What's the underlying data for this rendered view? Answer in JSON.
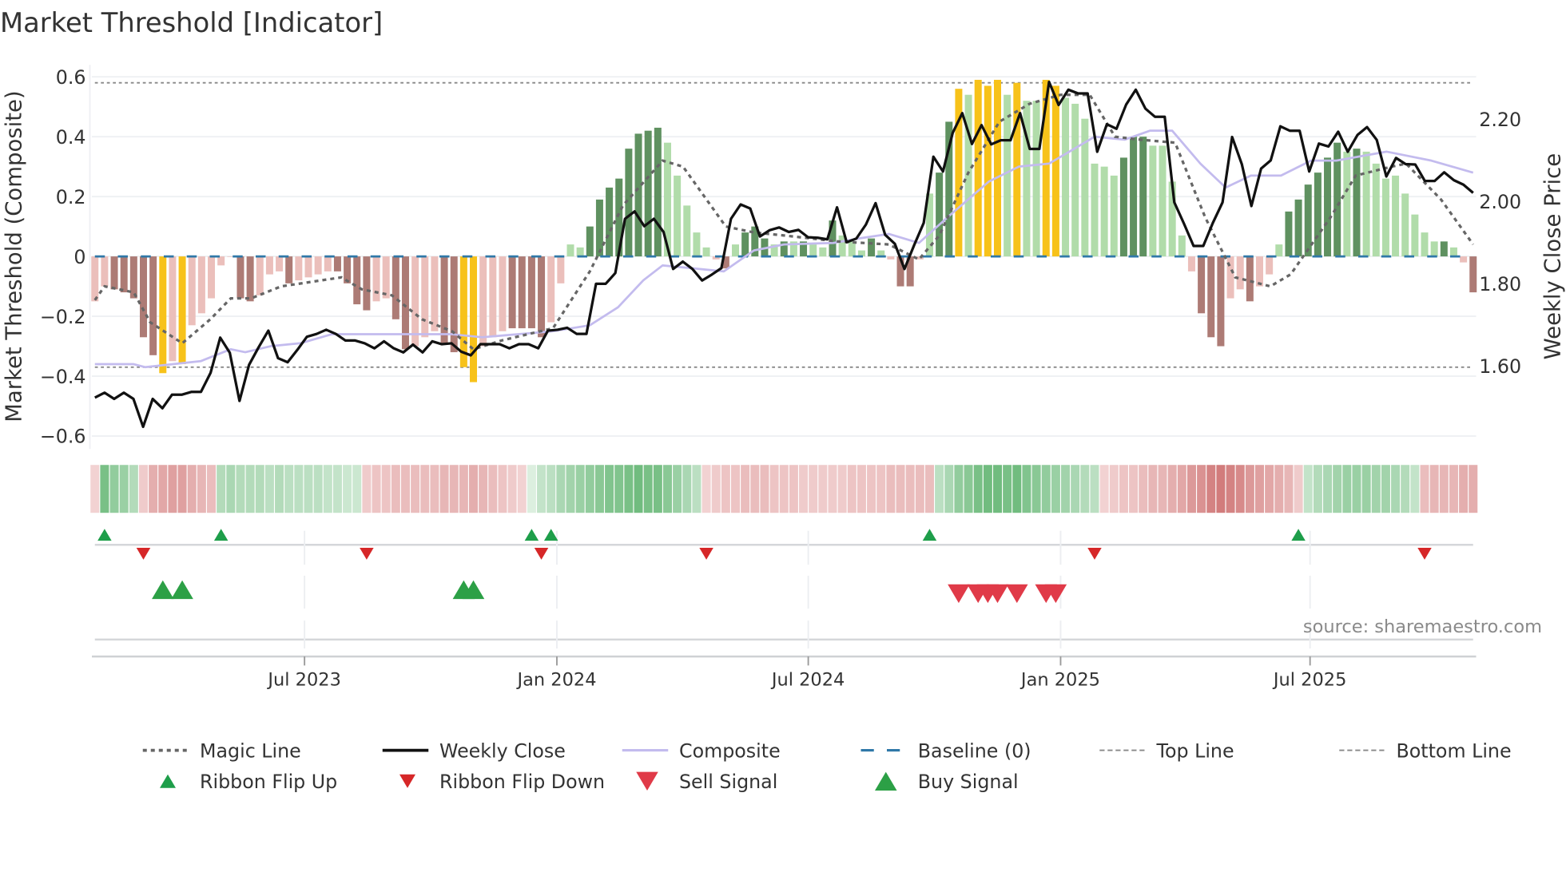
{
  "chart_data": {
    "type": "bar",
    "title": "Market Threshold [Indicator]",
    "ylabel_left": "Market Threshold (Composite)",
    "ylabel_right": "Weekly Close Price",
    "source": "source: sharemaestro.com",
    "ylim_left": [
      -0.65,
      0.62
    ],
    "ylim_right": [
      1.44,
      2.31
    ],
    "left_ticks": [
      0.6,
      0.4,
      0.2,
      0,
      -0.2,
      -0.4,
      -0.6
    ],
    "left_tick_labels": [
      "0.6",
      "0.4",
      "0.2",
      "0",
      "−0.2",
      "−0.4",
      "−0.6"
    ],
    "right_ticks": [
      2.2,
      2.0,
      1.8,
      1.6
    ],
    "right_tick_labels": [
      "2.20",
      "2.00",
      "1.80",
      "1.60"
    ],
    "x_ticks": [
      {
        "week": 21.6,
        "label": "Jul 2023"
      },
      {
        "week": 47.6,
        "label": "Jan 2024"
      },
      {
        "week": 73.5,
        "label": "Jul 2024"
      },
      {
        "week": 99.5,
        "label": "Jan 2025"
      },
      {
        "week": 125.2,
        "label": "Jul 2025"
      }
    ],
    "top_line": 0.58,
    "bottom_line": -0.37,
    "baseline": 0,
    "state_colors": {
      "L": "#ebbfbb",
      "D": "#ad7b75",
      "Y": "#f7c21a",
      "g": "#b1dcaa",
      "G": "#5f9160"
    },
    "line_colors": {
      "magic": "#666666",
      "close": "#111111",
      "composite": "#c3bbee",
      "baseline": "#2f78a8",
      "threshold": "#888888"
    },
    "composite_bars": [
      [
        -0.15,
        "L"
      ],
      [
        -0.1,
        "L"
      ],
      [
        -0.11,
        "D"
      ],
      [
        -0.12,
        "D"
      ],
      [
        -0.14,
        "D"
      ],
      [
        -0.27,
        "D"
      ],
      [
        -0.33,
        "D"
      ],
      [
        -0.39,
        "Y"
      ],
      [
        -0.35,
        "L"
      ],
      [
        -0.36,
        "Y"
      ],
      [
        -0.23,
        "L"
      ],
      [
        -0.19,
        "L"
      ],
      [
        -0.14,
        "L"
      ],
      [
        -0.03,
        "L"
      ],
      [
        0,
        "L"
      ],
      [
        -0.14,
        "D"
      ],
      [
        -0.15,
        "D"
      ],
      [
        -0.13,
        "L"
      ],
      [
        -0.06,
        "L"
      ],
      [
        -0.05,
        "L"
      ],
      [
        -0.09,
        "D"
      ],
      [
        -0.08,
        "L"
      ],
      [
        -0.07,
        "L"
      ],
      [
        -0.06,
        "L"
      ],
      [
        -0.05,
        "L"
      ],
      [
        -0.05,
        "D"
      ],
      [
        -0.09,
        "D"
      ],
      [
        -0.16,
        "D"
      ],
      [
        -0.18,
        "D"
      ],
      [
        -0.15,
        "L"
      ],
      [
        -0.14,
        "L"
      ],
      [
        -0.21,
        "D"
      ],
      [
        -0.31,
        "D"
      ],
      [
        -0.3,
        "L"
      ],
      [
        -0.27,
        "L"
      ],
      [
        -0.25,
        "L"
      ],
      [
        -0.29,
        "D"
      ],
      [
        -0.32,
        "D"
      ],
      [
        -0.37,
        "Y"
      ],
      [
        -0.42,
        "Y"
      ],
      [
        -0.3,
        "L"
      ],
      [
        -0.27,
        "L"
      ],
      [
        -0.25,
        "L"
      ],
      [
        -0.24,
        "D"
      ],
      [
        -0.24,
        "D"
      ],
      [
        -0.24,
        "D"
      ],
      [
        -0.27,
        "D"
      ],
      [
        -0.22,
        "L"
      ],
      [
        -0.09,
        "L"
      ],
      [
        0.04,
        "g"
      ],
      [
        0.03,
        "g"
      ],
      [
        0.1,
        "G"
      ],
      [
        0.19,
        "G"
      ],
      [
        0.23,
        "G"
      ],
      [
        0.26,
        "G"
      ],
      [
        0.36,
        "G"
      ],
      [
        0.41,
        "G"
      ],
      [
        0.42,
        "G"
      ],
      [
        0.43,
        "G"
      ],
      [
        0.38,
        "g"
      ],
      [
        0.27,
        "g"
      ],
      [
        0.17,
        "g"
      ],
      [
        0.08,
        "g"
      ],
      [
        0.03,
        "g"
      ],
      [
        -0.01,
        "L"
      ],
      [
        -0.04,
        "D"
      ],
      [
        0.04,
        "g"
      ],
      [
        0.08,
        "G"
      ],
      [
        0.1,
        "G"
      ],
      [
        0.06,
        "G"
      ],
      [
        0.04,
        "g"
      ],
      [
        0.05,
        "G"
      ],
      [
        0.05,
        "g"
      ],
      [
        0.05,
        "G"
      ],
      [
        0.04,
        "g"
      ],
      [
        0.03,
        "g"
      ],
      [
        0.12,
        "G"
      ],
      [
        0.07,
        "g"
      ],
      [
        0.05,
        "g"
      ],
      [
        0.02,
        "g"
      ],
      [
        0.06,
        "G"
      ],
      [
        0.02,
        "g"
      ],
      [
        -0.01,
        "L"
      ],
      [
        -0.1,
        "D"
      ],
      [
        -0.1,
        "D"
      ],
      [
        -0.01,
        "L"
      ],
      [
        0.21,
        "g"
      ],
      [
        0.28,
        "G"
      ],
      [
        0.45,
        "G"
      ],
      [
        0.56,
        "Y"
      ],
      [
        0.54,
        "g"
      ],
      [
        0.59,
        "Y"
      ],
      [
        0.57,
        "Y"
      ],
      [
        0.59,
        "Y"
      ],
      [
        0.54,
        "g"
      ],
      [
        0.58,
        "Y"
      ],
      [
        0.52,
        "g"
      ],
      [
        0.52,
        "g"
      ],
      [
        0.59,
        "Y"
      ],
      [
        0.57,
        "Y"
      ],
      [
        0.53,
        "g"
      ],
      [
        0.51,
        "g"
      ],
      [
        0.46,
        "g"
      ],
      [
        0.31,
        "g"
      ],
      [
        0.3,
        "g"
      ],
      [
        0.27,
        "g"
      ],
      [
        0.33,
        "G"
      ],
      [
        0.4,
        "G"
      ],
      [
        0.4,
        "G"
      ],
      [
        0.37,
        "g"
      ],
      [
        0.37,
        "g"
      ],
      [
        0.25,
        "g"
      ],
      [
        0.07,
        "g"
      ],
      [
        -0.05,
        "L"
      ],
      [
        -0.19,
        "D"
      ],
      [
        -0.27,
        "D"
      ],
      [
        -0.3,
        "D"
      ],
      [
        -0.14,
        "L"
      ],
      [
        -0.11,
        "L"
      ],
      [
        -0.15,
        "D"
      ],
      [
        -0.1,
        "L"
      ],
      [
        -0.06,
        "L"
      ],
      [
        0.04,
        "g"
      ],
      [
        0.15,
        "G"
      ],
      [
        0.19,
        "G"
      ],
      [
        0.24,
        "G"
      ],
      [
        0.28,
        "G"
      ],
      [
        0.33,
        "G"
      ],
      [
        0.38,
        "G"
      ],
      [
        0.35,
        "g"
      ],
      [
        0.36,
        "G"
      ],
      [
        0.35,
        "g"
      ],
      [
        0.31,
        "g"
      ],
      [
        0.26,
        "g"
      ],
      [
        0.27,
        "g"
      ],
      [
        0.21,
        "g"
      ],
      [
        0.14,
        "g"
      ],
      [
        0.08,
        "g"
      ],
      [
        0.05,
        "g"
      ],
      [
        0.05,
        "G"
      ],
      [
        0.03,
        "g"
      ],
      [
        -0.02,
        "L"
      ],
      [
        -0.12,
        "D"
      ]
    ],
    "weekly_close": [
      1.523,
      1.535,
      1.52,
      1.535,
      1.52,
      1.452,
      1.52,
      1.497,
      1.53,
      1.53,
      1.537,
      1.537,
      1.583,
      1.669,
      1.632,
      1.515,
      1.603,
      1.646,
      1.686,
      1.619,
      1.609,
      1.639,
      1.671,
      1.678,
      1.688,
      1.678,
      1.662,
      1.662,
      1.655,
      1.643,
      1.66,
      1.643,
      1.633,
      1.652,
      1.633,
      1.66,
      1.653,
      1.655,
      1.635,
      1.626,
      1.653,
      1.653,
      1.653,
      1.643,
      1.653,
      1.653,
      1.643,
      1.686,
      1.688,
      1.693,
      1.678,
      1.678,
      1.8,
      1.8,
      1.826,
      1.958,
      1.976,
      1.94,
      1.958,
      1.926,
      1.836,
      1.854,
      1.836,
      1.808,
      1.822,
      1.838,
      1.958,
      1.993,
      1.983,
      1.915,
      1.93,
      1.937,
      1.926,
      1.931,
      1.913,
      1.912,
      1.908,
      1.986,
      1.901,
      1.91,
      1.944,
      1.996,
      1.919,
      1.897,
      1.836,
      1.894,
      1.948,
      2.109,
      2.073,
      2.167,
      2.215,
      2.14,
      2.186,
      2.139,
      2.149,
      2.149,
      2.215,
      2.128,
      2.128,
      2.291,
      2.235,
      2.272,
      2.263,
      2.263,
      2.121,
      2.188,
      2.177,
      2.236,
      2.272,
      2.226,
      2.206,
      2.206,
      1.998,
      1.946,
      1.892,
      1.892,
      1.948,
      1.998,
      2.157,
      2.091,
      1.989,
      2.08,
      2.1,
      2.183,
      2.172,
      2.172,
      2.073,
      2.141,
      2.134,
      2.17,
      2.121,
      2.162,
      2.181,
      2.15,
      2.061,
      2.106,
      2.091,
      2.09,
      2.05,
      2.05,
      2.071,
      2.052,
      2.041,
      2.021
    ],
    "composite_line": [
      [
        0,
        -0.36
      ],
      [
        4,
        -0.36
      ],
      [
        5.2,
        -0.37
      ],
      [
        10.9,
        -0.35
      ],
      [
        14,
        -0.31
      ],
      [
        15.5,
        -0.32
      ],
      [
        18.1,
        -0.3
      ],
      [
        21.2,
        -0.29
      ],
      [
        24.4,
        -0.26
      ],
      [
        29.5,
        -0.26
      ],
      [
        36.8,
        -0.26
      ],
      [
        39.9,
        -0.27
      ],
      [
        47.2,
        -0.25
      ],
      [
        51,
        -0.23
      ],
      [
        53.9,
        -0.17
      ],
      [
        56.5,
        -0.08
      ],
      [
        58.5,
        -0.03
      ],
      [
        61.7,
        -0.04
      ],
      [
        64.8,
        -0.05
      ],
      [
        67.9,
        0.02
      ],
      [
        71,
        0.04
      ],
      [
        76.1,
        0.045
      ],
      [
        78.7,
        0.06
      ],
      [
        81.8,
        0.075
      ],
      [
        84.9,
        0.045
      ],
      [
        88,
        0.135
      ],
      [
        92.1,
        0.25
      ],
      [
        95.2,
        0.3
      ],
      [
        98.3,
        0.31
      ],
      [
        100.4,
        0.35
      ],
      [
        103,
        0.4
      ],
      [
        106.1,
        0.39
      ],
      [
        108.7,
        0.42
      ],
      [
        111,
        0.42
      ],
      [
        113.9,
        0.31
      ],
      [
        116.5,
        0.23
      ],
      [
        119.1,
        0.27
      ],
      [
        122.2,
        0.27
      ],
      [
        125.3,
        0.32
      ],
      [
        127.9,
        0.32
      ],
      [
        133.1,
        0.35
      ],
      [
        137.7,
        0.32
      ],
      [
        142,
        0.28
      ]
    ],
    "magic_line": [
      [
        0,
        -0.146
      ],
      [
        1,
        -0.1
      ],
      [
        4,
        -0.12
      ],
      [
        5.7,
        -0.22
      ],
      [
        9,
        -0.29
      ],
      [
        11.9,
        -0.21
      ],
      [
        14,
        -0.14
      ],
      [
        16.1,
        -0.14
      ],
      [
        19.2,
        -0.1
      ],
      [
        25.4,
        -0.07
      ],
      [
        27.5,
        -0.11
      ],
      [
        30.6,
        -0.13
      ],
      [
        33.7,
        -0.21
      ],
      [
        36.8,
        -0.25
      ],
      [
        39,
        -0.31
      ],
      [
        42,
        -0.28
      ],
      [
        47.2,
        -0.24
      ],
      [
        51,
        -0.05
      ],
      [
        54.4,
        0.17
      ],
      [
        58.5,
        0.32
      ],
      [
        60.6,
        0.3
      ],
      [
        65,
        0.1
      ],
      [
        67.9,
        0.08
      ],
      [
        71,
        0.07
      ],
      [
        76.6,
        0.05
      ],
      [
        81.8,
        0.04
      ],
      [
        84.9,
        -0.01
      ],
      [
        87,
        0.07
      ],
      [
        90,
        0.28
      ],
      [
        93.2,
        0.45
      ],
      [
        96.3,
        0.51
      ],
      [
        99.5,
        0.54
      ],
      [
        102.5,
        0.54
      ],
      [
        105.1,
        0.4
      ],
      [
        107.7,
        0.39
      ],
      [
        111.3,
        0.38
      ],
      [
        114.4,
        0.13
      ],
      [
        117.5,
        -0.07
      ],
      [
        121.1,
        -0.1
      ],
      [
        123.2,
        -0.06
      ],
      [
        127.3,
        0.13
      ],
      [
        129.9,
        0.27
      ],
      [
        133.6,
        0.3
      ],
      [
        135.1,
        0.31
      ],
      [
        138.7,
        0.19
      ],
      [
        142,
        0.04
      ]
    ],
    "ribbon": [
      -0.15,
      0.7,
      0.55,
      0.5,
      0.35,
      -0.2,
      -0.4,
      -0.45,
      -0.5,
      -0.5,
      -0.4,
      -0.35,
      -0.3,
      0.35,
      0.4,
      0.35,
      0.35,
      0.35,
      0.3,
      0.35,
      0.3,
      0.3,
      0.3,
      0.3,
      0.25,
      0.25,
      0.2,
      0.2,
      -0.2,
      -0.25,
      -0.25,
      -0.3,
      -0.3,
      -0.3,
      -0.3,
      -0.3,
      -0.35,
      -0.35,
      -0.35,
      -0.4,
      -0.35,
      -0.3,
      -0.25,
      -0.2,
      -0.15,
      0.1,
      0.25,
      0.3,
      0.4,
      0.45,
      0.5,
      0.55,
      0.6,
      0.65,
      0.65,
      0.7,
      0.75,
      0.7,
      0.7,
      0.6,
      0.5,
      0.4,
      0.3,
      -0.15,
      -0.2,
      -0.25,
      -0.25,
      -0.3,
      -0.3,
      -0.3,
      -0.25,
      -0.25,
      -0.25,
      -0.2,
      -0.2,
      -0.2,
      -0.2,
      -0.2,
      -0.25,
      -0.25,
      -0.25,
      -0.25,
      -0.3,
      -0.3,
      -0.3,
      -0.3,
      -0.3,
      0.3,
      0.4,
      0.55,
      0.6,
      0.7,
      0.75,
      0.75,
      0.7,
      0.75,
      0.65,
      0.6,
      0.55,
      0.5,
      0.45,
      0.4,
      0.35,
      0.3,
      -0.15,
      -0.2,
      -0.25,
      -0.25,
      -0.3,
      -0.35,
      -0.35,
      -0.4,
      -0.45,
      -0.55,
      -0.6,
      -0.7,
      -0.75,
      -0.7,
      -0.65,
      -0.55,
      -0.5,
      -0.45,
      -0.4,
      -0.35,
      -0.2,
      0.25,
      0.35,
      0.4,
      0.45,
      0.5,
      0.5,
      0.5,
      0.45,
      0.45,
      0.4,
      0.35,
      0.25,
      -0.3,
      -0.35,
      -0.35,
      -0.35,
      -0.4,
      -0.4
    ],
    "ribbon_flip_up_weeks": [
      1,
      13,
      45,
      47,
      86,
      124
    ],
    "ribbon_flip_down_weeks": [
      5,
      28,
      46,
      63,
      103,
      137
    ],
    "buy_signal_weeks": [
      7,
      9,
      38,
      39
    ],
    "sell_signal_weeks": [
      89,
      91,
      92,
      93,
      95,
      98,
      99
    ],
    "legend": [
      {
        "label": "Magic Line",
        "kind": "dotted",
        "color": "#666666"
      },
      {
        "label": "Weekly Close",
        "kind": "solid",
        "color": "#111111"
      },
      {
        "label": "Composite",
        "kind": "solid-thin",
        "color": "#c3bbee"
      },
      {
        "label": "Baseline (0)",
        "kind": "dashed",
        "color": "#2f78a8"
      },
      {
        "label": "Top Line",
        "kind": "fine-dash",
        "color": "#888888"
      },
      {
        "label": "Bottom Line",
        "kind": "fine-dash",
        "color": "#888888"
      },
      {
        "label": "Ribbon Flip Up",
        "kind": "tri-up-small",
        "color": "#1e9e4a"
      },
      {
        "label": "Ribbon Flip Down",
        "kind": "tri-down-small",
        "color": "#d62728"
      },
      {
        "label": "Sell Signal",
        "kind": "tri-down",
        "color": "#e03a48"
      },
      {
        "label": "Buy Signal",
        "kind": "tri-up",
        "color": "#2ca046"
      }
    ]
  }
}
